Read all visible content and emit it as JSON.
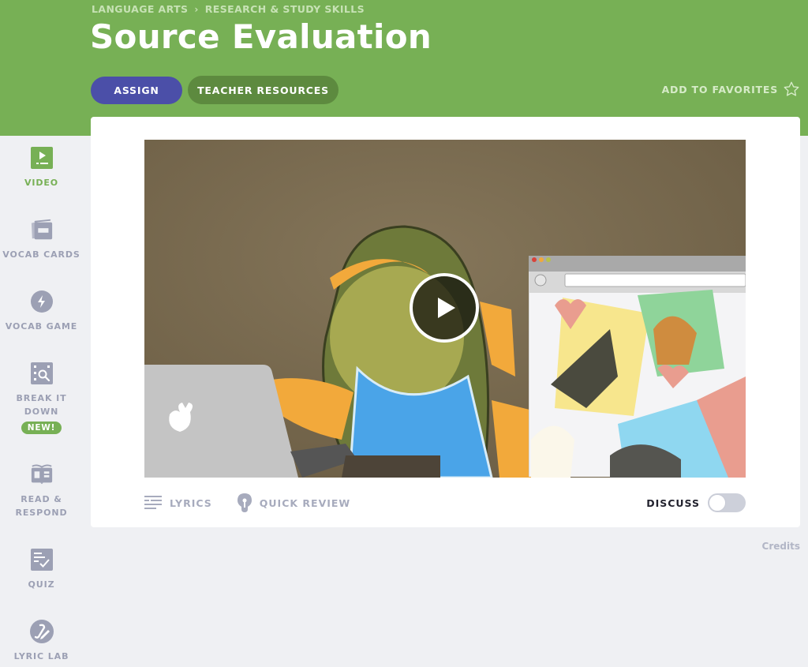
{
  "breadcrumb": [
    "LANGUAGE ARTS",
    "RESEARCH & STUDY SKILLS"
  ],
  "breadcrumb_separator": "›",
  "title": "Source Evaluation",
  "actions": {
    "assign": "ASSIGN",
    "teacher_resources": "TEACHER RESOURCES",
    "favorites": "ADD TO FAVORITES"
  },
  "sidebar": {
    "items": [
      {
        "label": "VIDEO",
        "icon": "video-icon",
        "active": true
      },
      {
        "label": "VOCAB CARDS",
        "icon": "vocab-cards-icon"
      },
      {
        "label": "VOCAB GAME",
        "icon": "lightning-icon"
      },
      {
        "label": "BREAK IT DOWN",
        "icon": "magnify-grid-icon",
        "badge": "NEW!"
      },
      {
        "label": "READ & RESPOND",
        "icon": "book-icon"
      },
      {
        "label": "QUIZ",
        "icon": "quiz-check-icon"
      },
      {
        "label": "LYRIC LAB",
        "icon": "lyric-lab-icon"
      }
    ]
  },
  "video": {
    "play_icon": "play-icon",
    "controls": {
      "lyrics": "LYRICS",
      "quick_review": "QUICK REVIEW",
      "discuss": "DISCUSS",
      "discuss_enabled": false
    }
  },
  "footer": {
    "credits": "Credits"
  },
  "colors": {
    "brand_green": "#77b055",
    "assign_blue": "#4b4fa8",
    "teacher_green": "#5d8a3f",
    "sidebar_gray": "#9ca0b4"
  }
}
